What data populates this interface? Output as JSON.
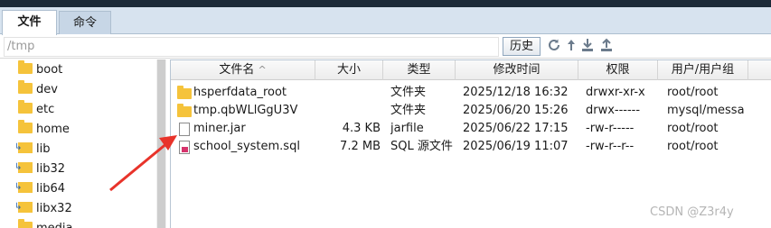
{
  "tabs": [
    {
      "label": "文件"
    },
    {
      "label": "命令"
    }
  ],
  "path": {
    "value": "/tmp"
  },
  "toolbar": {
    "history_label": "历史",
    "icons": [
      "refresh-icon",
      "up-directory-icon",
      "download-icon",
      "upload-icon"
    ]
  },
  "tree": {
    "items": [
      {
        "label": "boot",
        "icon": "folder-icon"
      },
      {
        "label": "dev",
        "icon": "folder-icon"
      },
      {
        "label": "etc",
        "icon": "folder-icon"
      },
      {
        "label": "home",
        "icon": "folder-icon"
      },
      {
        "label": "lib",
        "icon": "folder-link-icon"
      },
      {
        "label": "lib32",
        "icon": "folder-link-icon"
      },
      {
        "label": "lib64",
        "icon": "folder-link-icon"
      },
      {
        "label": "libx32",
        "icon": "folder-link-icon"
      },
      {
        "label": "media",
        "icon": "folder-icon"
      }
    ]
  },
  "files": {
    "columns": {
      "name": "文件名",
      "sort_indicator": "^",
      "size": "大小",
      "type": "类型",
      "mtime": "修改时间",
      "perm": "权限",
      "owner": "用户/用户组"
    },
    "rows": [
      {
        "name": "hsperfdata_root",
        "size": "",
        "type": "文件夹",
        "mtime": "2025/12/18 16:32",
        "perm": "drwxr-xr-x",
        "owner": "root/root",
        "icon": "folder-icon"
      },
      {
        "name": "tmp.qbWLlGgU3V",
        "size": "",
        "type": "文件夹",
        "mtime": "2025/06/20 15:26",
        "perm": "drwx------",
        "owner": "mysql/messa",
        "icon": "folder-icon"
      },
      {
        "name": "miner.jar",
        "size": "4.3 KB",
        "type": "jarfile",
        "mtime": "2025/06/22 17:15",
        "perm": "-rw-r-----",
        "owner": "root/root",
        "icon": "file-icon"
      },
      {
        "name": "school_system.sql",
        "size": "7.2 MB",
        "type": "SQL 源文件",
        "mtime": "2025/06/19 11:07",
        "perm": "-rw-r--r--",
        "owner": "root/root",
        "icon": "sql-file-icon"
      }
    ]
  },
  "annotation": {
    "color": "#e8332a"
  },
  "watermark": "CSDN @Z3r4y",
  "colors": {
    "tab_bg": "#d7e3ef",
    "folder": "#f5c33b",
    "arrow": "#e8332a"
  }
}
